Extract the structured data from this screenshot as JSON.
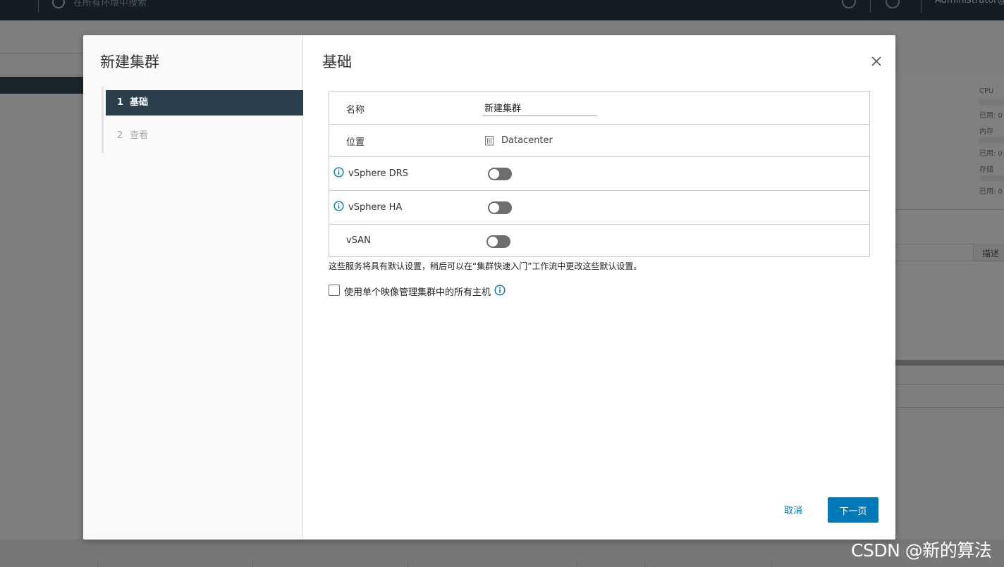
{
  "background": {
    "search_placeholder": "在所有环境中搜索",
    "user": "Administrator@",
    "right_panel": {
      "cpu_label": "CPU",
      "used_label": "已用: 0",
      "memory_label": "内存",
      "storage_label": "存储"
    },
    "table_header_desc": "描述"
  },
  "watermark": "CSDN @新的算法",
  "dialog": {
    "wizard_title": "新建集群",
    "steps": [
      {
        "num": "1",
        "label": "基础"
      },
      {
        "num": "2",
        "label": "查看"
      }
    ],
    "content_title": "基础",
    "form": {
      "name_label": "名称",
      "name_value": "新建集群",
      "location_label": "位置",
      "location_value": "Datacenter",
      "drs_label": "vSphere DRS",
      "ha_label": "vSphere HA",
      "vsan_label": "vSAN"
    },
    "note": "这些服务将具有默认设置，稍后可以在“集群快速入门”工作流中更改这些默认设置。",
    "image_checkbox_label": "使用单个映像管理集群中的所有主机",
    "cancel_label": "取消",
    "next_label": "下一页"
  },
  "colors": {
    "primary": "#0079b8",
    "nav_active": "#2b3e4b",
    "info_icon": "#0072a3",
    "toggle_off": "#6e6e6e"
  }
}
